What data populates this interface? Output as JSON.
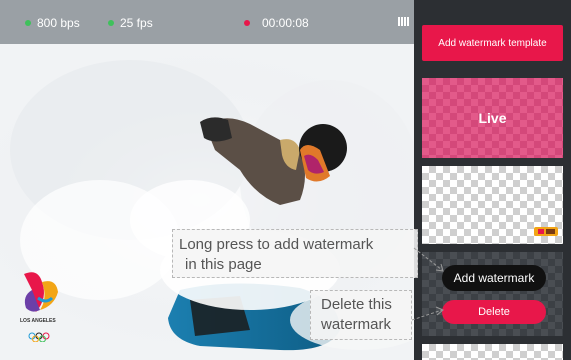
{
  "status": {
    "bitrate": "800 bps",
    "framerate": "25 fps",
    "recording_time": "00:00:08",
    "indicator_colors": {
      "ok": "#3ec15b",
      "recording": "#e8174a"
    }
  },
  "stream": {
    "scene": "snowboarder spraying snow",
    "logo": {
      "text": "LOS ANGELES",
      "icon": "la-olympic-logo-icon"
    }
  },
  "panel": {
    "add_template_label": "Add watermark template",
    "tiles": [
      {
        "label": "Live",
        "style": "pink-checker"
      },
      {
        "label": "",
        "style": "white-checker",
        "thumb_icon": "watermark-thumbnail-icon"
      },
      {
        "label": "",
        "style": "dark-checker"
      }
    ]
  },
  "actions": {
    "add_watermark_label": "Add watermark",
    "delete_label": "Delete"
  },
  "tooltips": {
    "long_press_line1": "Long press to add watermark",
    "long_press_line2": "in this page",
    "delete_line1": "Delete this",
    "delete_line2": "watermark"
  },
  "colors": {
    "accent": "#e8174a",
    "panel_bg": "#2c2f33",
    "statusbar_bg": "#9aa0a5"
  }
}
